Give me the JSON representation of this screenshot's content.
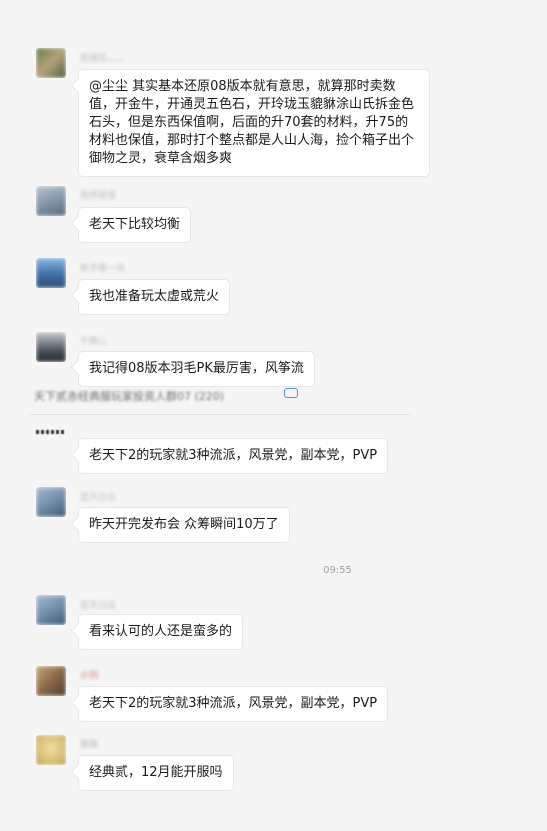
{
  "messages": [
    {
      "name": "管理员。。。。",
      "text": "@尘尘 其实基本还原08版本就有意思，就算那时卖数值，开金牛，开通灵五色石，开玲珑玉貔貅涂山氏拆金色石头，但是东西保值啊，后面的升70套的材料，升75的材料也保值，那时打个整点都是人山人海，捡个箱子出个御物之灵，衰草含烟多爽",
      "avatar_color": "#6b7b4a"
    },
    {
      "name": "南师是我",
      "text": "老天下比较均衡",
      "avatar_color": "#7a8ea0"
    },
    {
      "name": "新手哪一找",
      "text": "我也准备玩太虚或荒火",
      "avatar_color": "#3d6fa8"
    },
    {
      "name": "不期心",
      "text": "我记得08版本羽毛PK最厉害，风筝流",
      "avatar_color": "#4d5660"
    },
    {
      "name": "",
      "text": "老天下2的玩家就3种流派，风景党，副本党，PVP",
      "avatar_color": "#333333"
    },
    {
      "name": "蓝天白云",
      "text": "昨天开完发布会 众筹瞬间10万了",
      "avatar_color": "#6e8aa8"
    },
    {
      "name": "蓝天白云",
      "text": "看来认可的人还是蛮多的",
      "avatar_color": "#6e8aa8"
    },
    {
      "name": "小刘",
      "text": "老天下2的玩家就3种流派，风景党，副本党，PVP",
      "avatar_color": "#8a6a4a"
    },
    {
      "name": "猫猫",
      "text": "经典贰，12月能开服吗",
      "avatar_color": "#d9c27a"
    }
  ],
  "quote": {
    "title": "天下贰赤经典服玩家投资人群07 (220)"
  },
  "time_label": "09:55"
}
